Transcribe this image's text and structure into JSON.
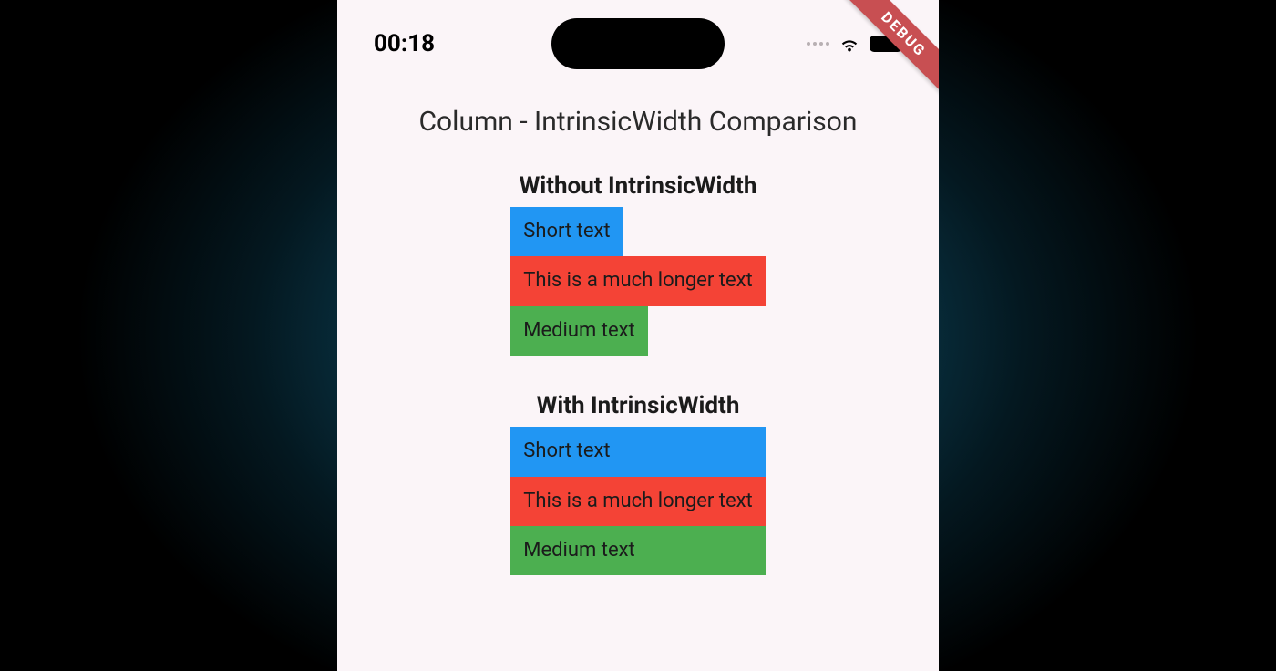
{
  "status": {
    "time": "00:18"
  },
  "banner": {
    "label": "DEBUG"
  },
  "page": {
    "title": "Column - IntrinsicWidth Comparison"
  },
  "sections": {
    "without": {
      "heading": "Without IntrinsicWidth",
      "items": {
        "a": "Short text",
        "b": "This is a much longer text",
        "c": "Medium text"
      }
    },
    "with": {
      "heading": "With IntrinsicWidth",
      "items": {
        "a": "Short text",
        "b": "This is a much longer text",
        "c": "Medium text"
      }
    }
  },
  "colors": {
    "blue": "#2196f3",
    "red": "#f44336",
    "green": "#4caf50"
  }
}
